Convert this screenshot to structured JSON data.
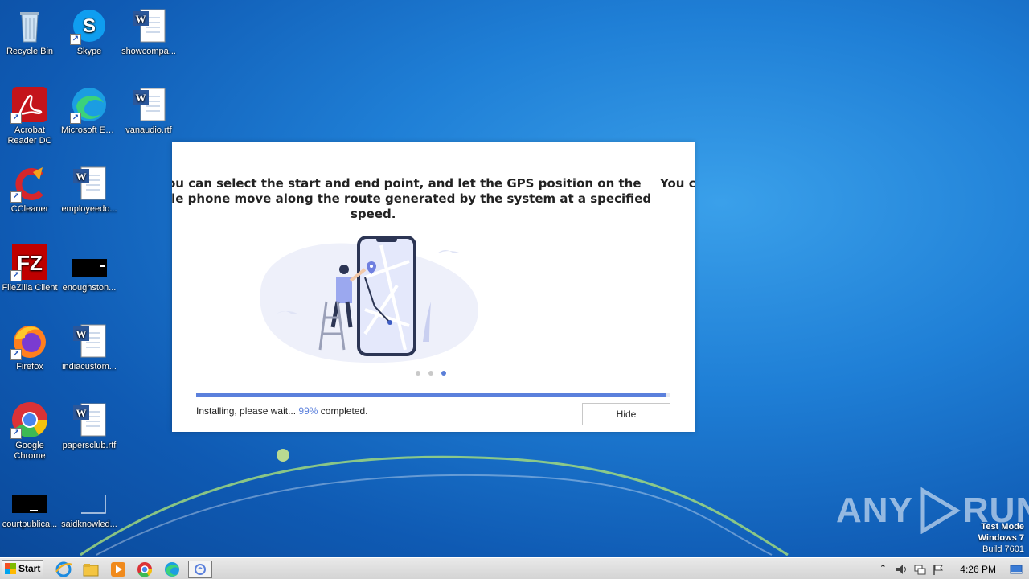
{
  "desktop": {
    "icons": [
      {
        "label": "Recycle Bin"
      },
      {
        "label": "Skype"
      },
      {
        "label": "showcompa..."
      },
      {
        "label": "Acrobat Reader DC"
      },
      {
        "label": "Microsoft Edge"
      },
      {
        "label": "vanaudio.rtf"
      },
      {
        "label": "CCleaner"
      },
      {
        "label": "employeedo..."
      },
      {
        "label": "FileZilla Client"
      },
      {
        "label": "enoughston..."
      },
      {
        "label": "Firefox"
      },
      {
        "label": "indiacustom..."
      },
      {
        "label": "Google Chrome"
      },
      {
        "label": "papersclub.rtf"
      },
      {
        "label": "courtpublica..."
      },
      {
        "label": "saidknowled..."
      }
    ]
  },
  "installer": {
    "slide_line1": "ou can select the start and end point, and let the GPS position on the",
    "slide_line2": "ile phone move along the route generated by the system at a specified",
    "slide_line3": "speed.",
    "next_slide_peek": "You c",
    "progress_fraction": 0.99,
    "status_prefix": "Installing, please wait...",
    "status_percent": "99%",
    "status_suffix": "completed.",
    "hide_label": "Hide",
    "carousel": {
      "total": 3,
      "active": 3
    }
  },
  "watermark": {
    "text_left": "ANY",
    "text_right": "RUN"
  },
  "system_info": {
    "line1": "Test Mode",
    "line2": "Windows 7",
    "line3": "Build 7601"
  },
  "taskbar": {
    "start_label": "Start",
    "clock": "4:26 PM"
  },
  "colors": {
    "accent": "#5b80dc",
    "desktop_blue": "#1f7fd6"
  }
}
